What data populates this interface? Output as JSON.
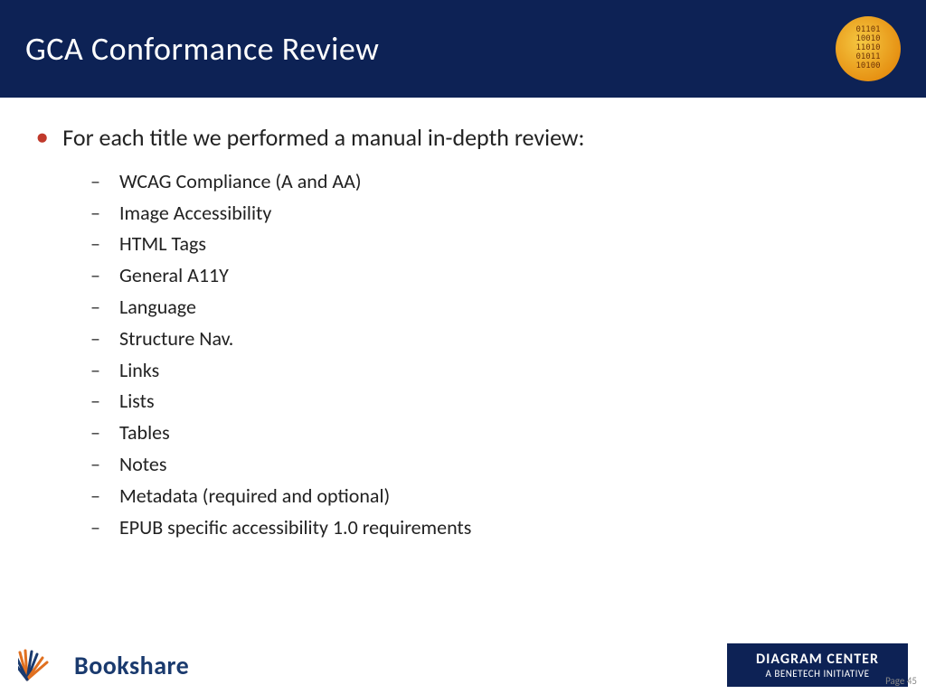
{
  "header": {
    "title": "GCA Conformance Review",
    "logo_alt": "Binary circle logo"
  },
  "main_bullet": {
    "text": "For each title we performed a manual in-depth review:"
  },
  "sub_items": [
    {
      "text": "WCAG Compliance (A and AA)"
    },
    {
      "text": "Image Accessibility"
    },
    {
      "text": "HTML Tags"
    },
    {
      "text": "General A11Y"
    },
    {
      "text": "Language"
    },
    {
      "text": "Structure Nav."
    },
    {
      "text": "Links"
    },
    {
      "text": "Lists"
    },
    {
      "text": "Tables"
    },
    {
      "text": "Notes"
    },
    {
      "text": "Metadata (required and optional)"
    },
    {
      "text": "EPUB specific accessibility 1.0 requirements"
    }
  ],
  "footer": {
    "bookshare_name": "Bookshare",
    "diagram_center_line1": "DIAGRAM CENTER",
    "diagram_center_line2": "A BENETECH INITIATIVE",
    "page_number": "Page 45"
  }
}
